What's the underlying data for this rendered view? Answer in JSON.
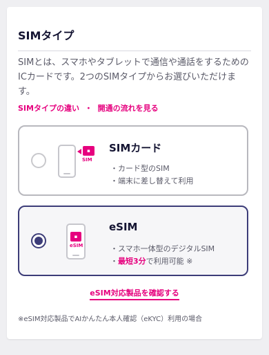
{
  "title": "SIMタイプ",
  "description": "SIMとは、スマホやタブレットで通信や通話をするためのICカードです。2つのSIMタイプからお選びいただけます。",
  "links": {
    "diff": "SIMタイプの違い",
    "sep": "・",
    "flow": "開通の流れを見る"
  },
  "options": [
    {
      "title": "SIMカード",
      "icon_label": "SIM",
      "feature1": "・カード型のSIM",
      "feature2": "・端末に差し替えて利用",
      "selected": false
    },
    {
      "title": "eSIM",
      "icon_label": "eSIM",
      "feature1": "・スマホ一体型のデジタルSIM",
      "feature2_prefix": "・",
      "feature2_highlight": "最短3分",
      "feature2_suffix": "で利用可能 ※",
      "selected": true
    }
  ],
  "check_link": "eSIM対応製品を確認する",
  "footnote": "※eSIM対応製品でAIかんたん本人確認（eKYC）利用の場合",
  "colors": {
    "accent": "#e6007e",
    "primary": "#3c3c78"
  }
}
